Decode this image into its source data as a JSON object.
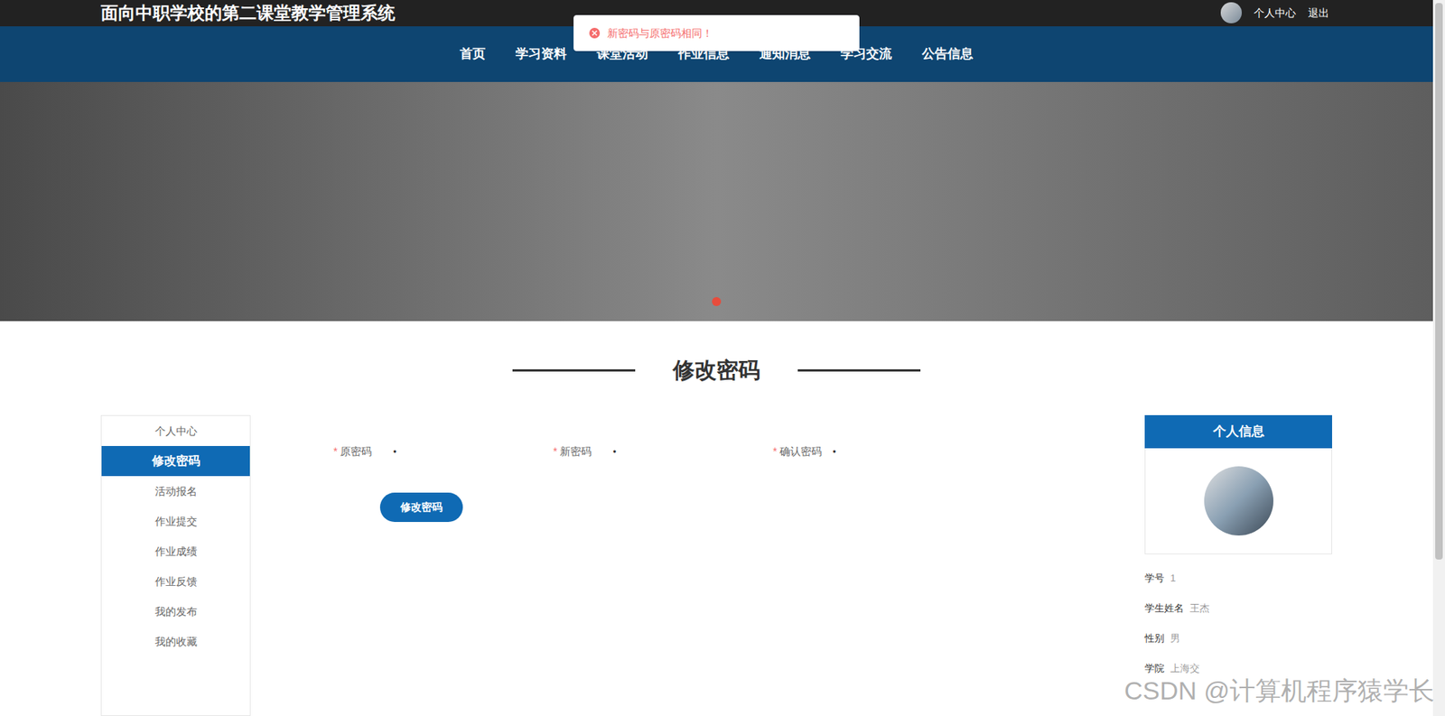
{
  "header": {
    "title": "面向中职学校的第二课堂教学管理系统",
    "user_links": [
      "个人中心",
      "退出"
    ]
  },
  "toast": {
    "message": "新密码与原密码相同！"
  },
  "nav": [
    {
      "label": "首页",
      "selected": false
    },
    {
      "label": "学习资料",
      "selected": false
    },
    {
      "label": "课堂活动",
      "selected": false
    },
    {
      "label": "作业信息",
      "selected": false
    },
    {
      "label": "通知消息",
      "selected": false
    },
    {
      "label": "学习交流",
      "selected": false
    },
    {
      "label": "公告信息",
      "selected": false
    }
  ],
  "banner": {
    "dots": [
      {
        "selected": true
      }
    ]
  },
  "page_title": "修改密码",
  "sidebar": [
    {
      "label": "个人中心",
      "selected": false
    },
    {
      "label": "修改密码",
      "selected": true
    },
    {
      "label": "活动报名",
      "selected": false
    },
    {
      "label": "作业提交",
      "selected": false
    },
    {
      "label": "作业成绩",
      "selected": false
    },
    {
      "label": "作业反馈",
      "selected": false
    },
    {
      "label": "我的发布",
      "selected": false
    },
    {
      "label": "我的收藏",
      "selected": false
    }
  ],
  "form": {
    "required_mark": "*",
    "fields": [
      {
        "label": "原密码",
        "required": true,
        "value": "•"
      },
      {
        "label": "新密码",
        "required": true,
        "value": "•"
      },
      {
        "label": "确认密码",
        "required": true,
        "value": "•"
      }
    ],
    "submit": "修改密码"
  },
  "profile": {
    "title": "个人信息",
    "rows": [
      {
        "label": "学号",
        "value": "1"
      },
      {
        "label": "学生姓名",
        "value": "王杰"
      },
      {
        "label": "性别",
        "value": "男"
      },
      {
        "label": "学院",
        "value": "上海交"
      }
    ]
  },
  "watermark": "CSDN @计算机程序猿学长"
}
